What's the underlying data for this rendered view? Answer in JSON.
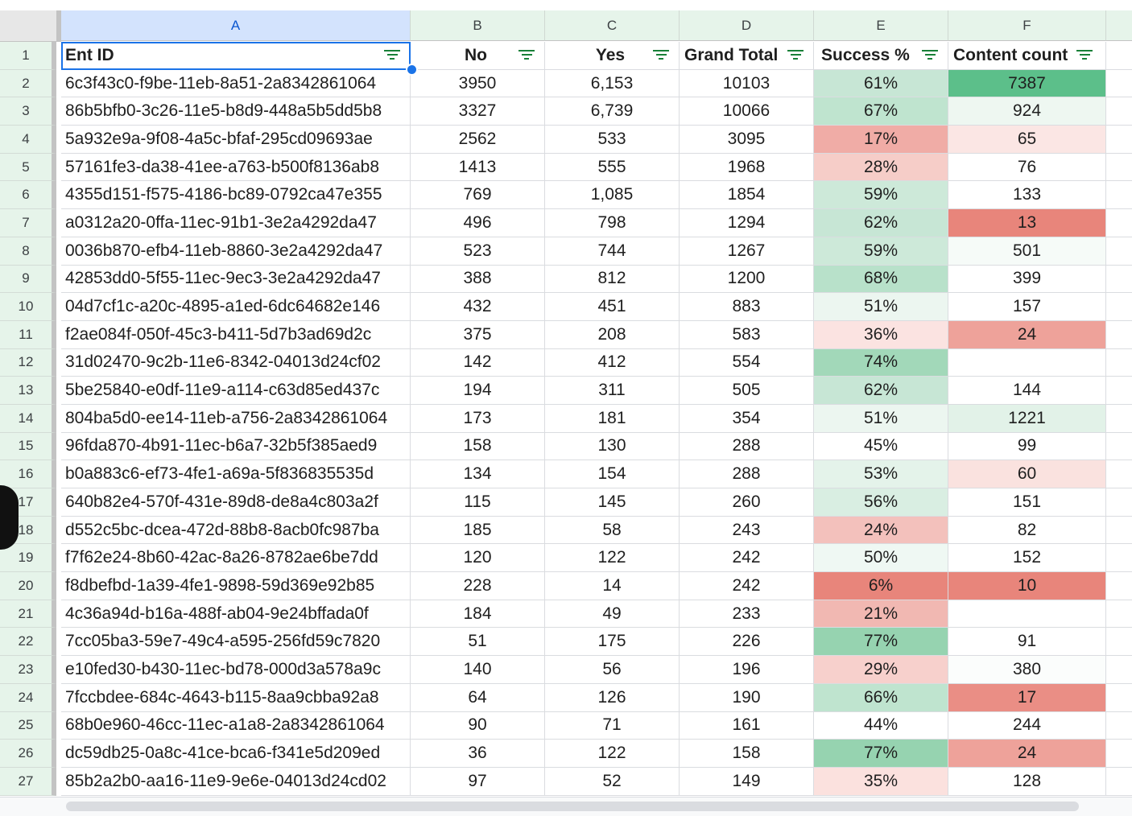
{
  "columns": [
    "A",
    "B",
    "C",
    "D",
    "E",
    "F"
  ],
  "header": {
    "ent_id": "Ent ID",
    "no": "No",
    "yes": "Yes",
    "grand_total": "Grand Total",
    "success": "Success %",
    "content_count": "Content count"
  },
  "rows": [
    {
      "num": "1"
    },
    {
      "num": "2",
      "id": "6c3f43c0-f9be-11eb-8a51-2a8342861064",
      "no": "3950",
      "yes": "6,153",
      "total": "10103",
      "success": "61%",
      "count": "7387",
      "success_color": "#c7e6d5",
      "count_color": "#5cbf8a"
    },
    {
      "num": "3",
      "id": "86b5bfb0-3c26-11e5-b8d9-448a5b5dd5b8",
      "no": "3327",
      "yes": "6,739",
      "total": "10066",
      "success": "67%",
      "count": "924",
      "success_color": "#bfe4cf",
      "count_color": "#eef7f1"
    },
    {
      "num": "4",
      "id": "5a932e9a-9f08-4a5c-bfaf-295cd09693ae",
      "no": "2562",
      "yes": "533",
      "total": "3095",
      "success": "17%",
      "count": "65",
      "success_color": "#f0aca6",
      "count_color": "#fbe6e4"
    },
    {
      "num": "5",
      "id": "57161fe3-da38-41ee-a763-b500f8136ab8",
      "no": "1413",
      "yes": "555",
      "total": "1968",
      "success": "28%",
      "count": "76",
      "success_color": "#f6cdc8",
      "count_color": "#ffffff"
    },
    {
      "num": "6",
      "id": "4355d151-f575-4186-bc89-0792ca47e355",
      "no": "769",
      "yes": "1,085",
      "total": "1854",
      "success": "59%",
      "count": "133",
      "success_color": "#cde9d9",
      "count_color": "#ffffff"
    },
    {
      "num": "7",
      "id": "a0312a20-0ffa-11ec-91b1-3e2a4292da47",
      "no": "496",
      "yes": "798",
      "total": "1294",
      "success": "62%",
      "count": "13",
      "success_color": "#c7e6d5",
      "count_color": "#e8857b"
    },
    {
      "num": "8",
      "id": "0036b870-efb4-11eb-8860-3e2a4292da47",
      "no": "523",
      "yes": "744",
      "total": "1267",
      "success": "59%",
      "count": "501",
      "success_color": "#cde9d9",
      "count_color": "#f6fbf8"
    },
    {
      "num": "9",
      "id": "42853dd0-5f55-11ec-9ec3-3e2a4292da47",
      "no": "388",
      "yes": "812",
      "total": "1200",
      "success": "68%",
      "count": "399",
      "success_color": "#b8e1ca",
      "count_color": "#ffffff"
    },
    {
      "num": "10",
      "id": "04d7cf1c-a20c-4895-a1ed-6dc64682e146",
      "no": "432",
      "yes": "451",
      "total": "883",
      "success": "51%",
      "count": "157",
      "success_color": "#ecf6f0",
      "count_color": "#ffffff"
    },
    {
      "num": "11",
      "id": "f2ae084f-050f-45c3-b411-5d7b3ad69d2c",
      "no": "375",
      "yes": "208",
      "total": "583",
      "success": "36%",
      "count": "24",
      "success_color": "#fbe3e1",
      "count_color": "#eea29a"
    },
    {
      "num": "12",
      "id": "31d02470-9c2b-11e6-8342-04013d24cf02",
      "no": "142",
      "yes": "412",
      "total": "554",
      "success": "74%",
      "count": "",
      "success_color": "#a2d8b9",
      "count_color": "#ffffff"
    },
    {
      "num": "13",
      "id": "5be25840-e0df-11e9-a114-c63d85ed437c",
      "no": "194",
      "yes": "311",
      "total": "505",
      "success": "62%",
      "count": "144",
      "success_color": "#c7e6d5",
      "count_color": "#ffffff"
    },
    {
      "num": "14",
      "id": "804ba5d0-ee14-11eb-a756-2a8342861064",
      "no": "173",
      "yes": "181",
      "total": "354",
      "success": "51%",
      "count": "1221",
      "success_color": "#ecf6f0",
      "count_color": "#e2f2e8"
    },
    {
      "num": "15",
      "id": "96fda870-4b91-11ec-b6a7-32b5f385aed9",
      "no": "158",
      "yes": "130",
      "total": "288",
      "success": "45%",
      "count": "99",
      "success_color": "#ffffff",
      "count_color": "#ffffff"
    },
    {
      "num": "16",
      "id": "b0a883c6-ef73-4fe1-a69a-5f836835535d",
      "no": "134",
      "yes": "154",
      "total": "288",
      "success": "53%",
      "count": "60",
      "success_color": "#e4f3ea",
      "count_color": "#fae2df"
    },
    {
      "num": "17",
      "id": "640b82e4-570f-431e-89d8-de8a4c803a2f",
      "no": "115",
      "yes": "145",
      "total": "260",
      "success": "56%",
      "count": "151",
      "success_color": "#d9eee2",
      "count_color": "#ffffff"
    },
    {
      "num": "18",
      "id": "d552c5bc-dcea-472d-88b8-8acb0fc987ba",
      "no": "185",
      "yes": "58",
      "total": "243",
      "success": "24%",
      "count": "82",
      "success_color": "#f3c1bc",
      "count_color": "#ffffff"
    },
    {
      "num": "19",
      "id": "f7f62e24-8b60-42ac-8a26-8782ae6be7dd",
      "no": "120",
      "yes": "122",
      "total": "242",
      "success": "50%",
      "count": "152",
      "success_color": "#eff8f3",
      "count_color": "#ffffff"
    },
    {
      "num": "20",
      "id": "f8dbefbd-1a39-4fe1-9898-59d369e92b85",
      "no": "228",
      "yes": "14",
      "total": "242",
      "success": "6%",
      "count": "10",
      "success_color": "#e8857b",
      "count_color": "#e8857b"
    },
    {
      "num": "21",
      "id": "4c36a94d-b16a-488f-ab04-9e24bffada0f",
      "no": "184",
      "yes": "49",
      "total": "233",
      "success": "21%",
      "count": "",
      "success_color": "#f1b8b2",
      "count_color": "#ffffff"
    },
    {
      "num": "22",
      "id": "7cc05ba3-59e7-49c4-a595-256fd59c7820",
      "no": "51",
      "yes": "175",
      "total": "226",
      "success": "77%",
      "count": "91",
      "success_color": "#96d3b0",
      "count_color": "#ffffff"
    },
    {
      "num": "23",
      "id": "e10fed30-b430-11ec-bd78-000d3a578a9c",
      "no": "140",
      "yes": "56",
      "total": "196",
      "success": "29%",
      "count": "380",
      "success_color": "#f7d0cc",
      "count_color": "#fbfdfc"
    },
    {
      "num": "24",
      "id": "7fccbdee-684c-4643-b115-8aa9cbba92a8",
      "no": "64",
      "yes": "126",
      "total": "190",
      "success": "66%",
      "count": "17",
      "success_color": "#bfe4cf",
      "count_color": "#ea8e85"
    },
    {
      "num": "25",
      "id": "68b0e960-46cc-11ec-a1a8-2a8342861064",
      "no": "90",
      "yes": "71",
      "total": "161",
      "success": "44%",
      "count": "244",
      "success_color": "#ffffff",
      "count_color": "#ffffff"
    },
    {
      "num": "26",
      "id": "dc59db25-0a8c-41ce-bca6-f341e5d209ed",
      "no": "36",
      "yes": "122",
      "total": "158",
      "success": "77%",
      "count": "24",
      "success_color": "#96d3b0",
      "count_color": "#eea29a"
    },
    {
      "num": "27",
      "id": "85b2a2b0-aa16-11e9-9e6e-04013d24cd02",
      "no": "97",
      "yes": "52",
      "total": "149",
      "success": "35%",
      "count": "128",
      "success_color": "#fbe1de",
      "count_color": "#ffffff"
    }
  ]
}
